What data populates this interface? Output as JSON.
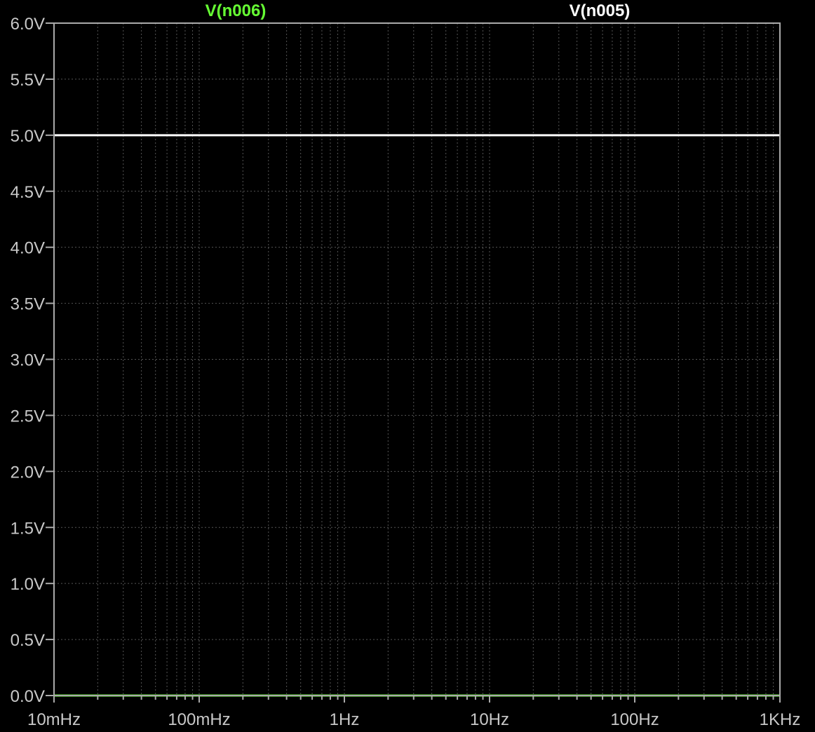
{
  "chart_data": {
    "type": "line",
    "x_scale": "log",
    "x_unit": "Hz",
    "xlim": [
      0.01,
      1000
    ],
    "ylim": [
      0,
      6
    ],
    "grid": true,
    "background": "#000000",
    "grid_color": "#555555",
    "axis_color": "#aaaaaa",
    "x_tick_values": [
      0.01,
      0.1,
      1,
      10,
      100,
      1000
    ],
    "x_tick_labels": [
      "10mHz",
      "100mHz",
      "1Hz",
      "10Hz",
      "100Hz",
      "1KHz"
    ],
    "y_tick_values": [
      0,
      0.5,
      1,
      1.5,
      2,
      2.5,
      3,
      3.5,
      4,
      4.5,
      5,
      5.5,
      6
    ],
    "y_tick_labels": [
      "0.0V",
      "0.5V",
      "1.0V",
      "1.5V",
      "2.0V",
      "2.5V",
      "3.0V",
      "3.5V",
      "4.0V",
      "4.5V",
      "5.0V",
      "5.5V",
      "6.0V"
    ],
    "legend_placement": "top",
    "series": [
      {
        "name": "V(n006)",
        "color": "#66ff33",
        "x": [
          0.01,
          1000
        ],
        "y": [
          0,
          0
        ]
      },
      {
        "name": "V(n005)",
        "color": "#ffffff",
        "x": [
          0.01,
          1000
        ],
        "y": [
          5,
          5
        ]
      }
    ]
  }
}
